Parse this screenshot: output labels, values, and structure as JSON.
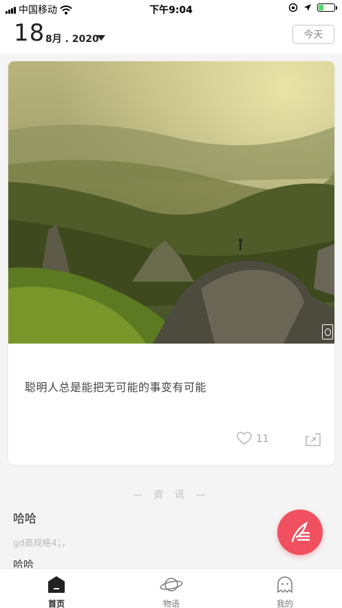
{
  "status_bar": {
    "carrier": "中国移动",
    "time": "下午9:04",
    "battery_level": 0.3,
    "battery_color": "#4cd964"
  },
  "header": {
    "day": "18",
    "month_year": "8月 . 2020",
    "today_label": "今天"
  },
  "card": {
    "quote": "聪明人总是能把无可能的事变有可能",
    "like_count": "11",
    "icons": [
      "heart-icon",
      "share-icon",
      "live-photo-icon"
    ]
  },
  "news": {
    "section_label": "— 资 讯 —",
    "title": "哈哈",
    "desc": "gd高规格4；，",
    "next_title": "哈哈"
  },
  "fab": {
    "icon": "quill-icon",
    "color": "#f0505f"
  },
  "tabs": [
    {
      "label": "首页",
      "icon": "home-icon",
      "active": true
    },
    {
      "label": "物语",
      "icon": "planet-icon",
      "active": false
    },
    {
      "label": "我的",
      "icon": "ghost-profile-icon",
      "active": false
    }
  ]
}
